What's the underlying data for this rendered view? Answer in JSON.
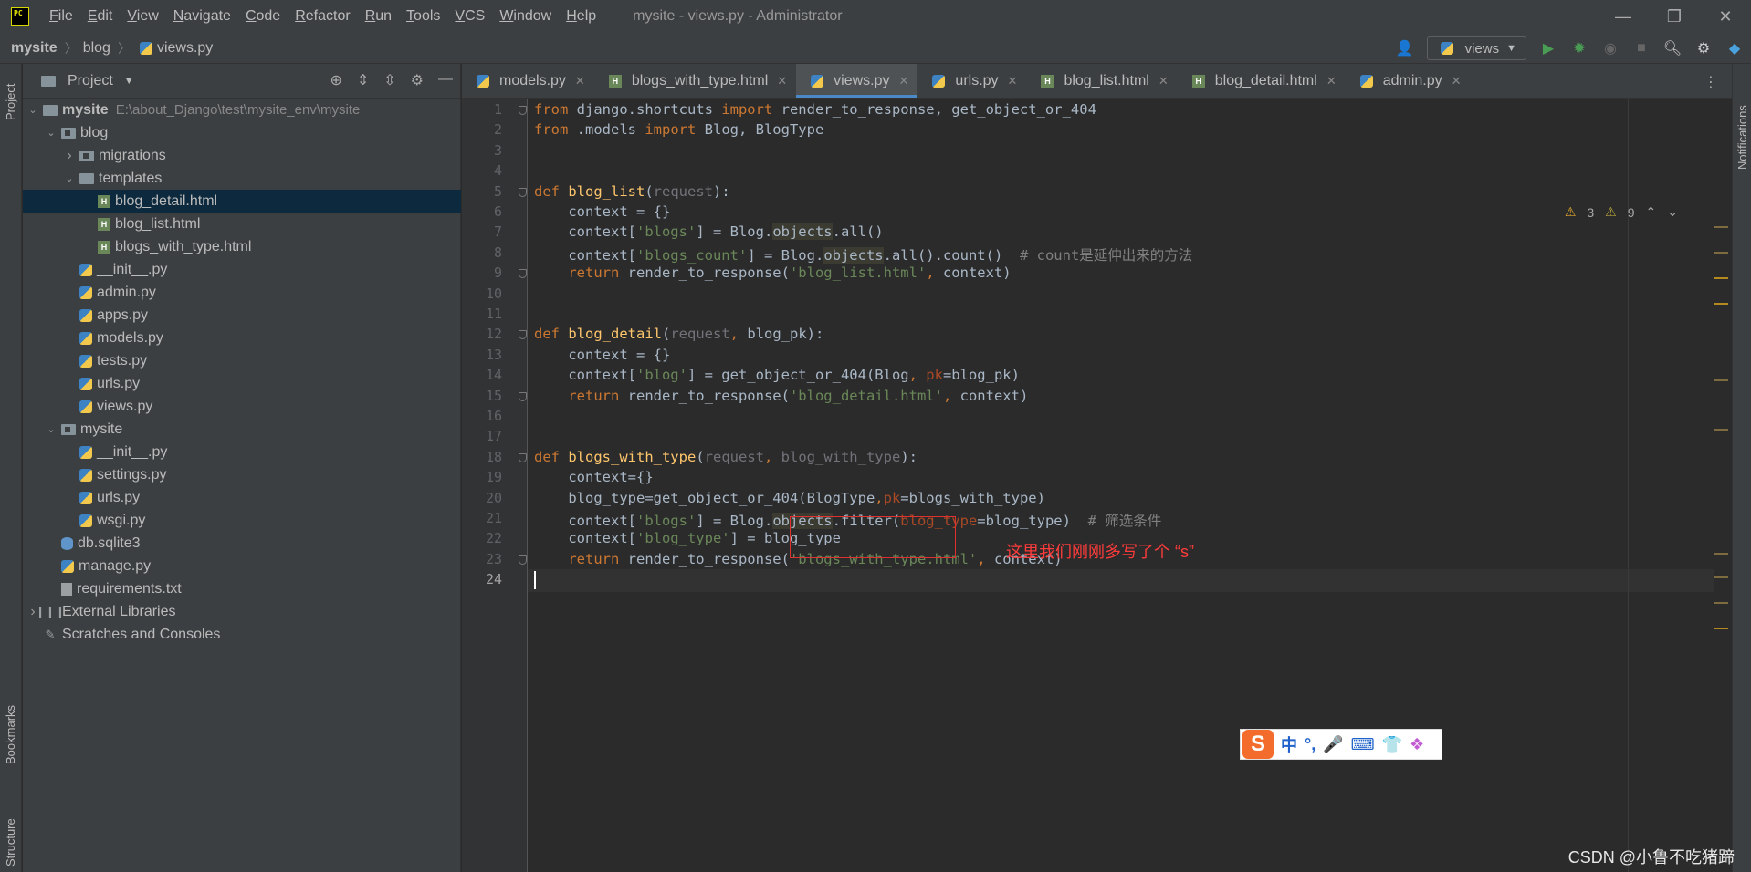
{
  "app": {
    "title": "mysite - views.py - Administrator",
    "logo_text": "PC",
    "menu": [
      {
        "label": "File",
        "key": "F",
        "rest": "ile"
      },
      {
        "label": "Edit",
        "key": "E",
        "rest": "dit"
      },
      {
        "label": "View",
        "key": "V",
        "rest": "iew"
      },
      {
        "label": "Navigate",
        "key": "N",
        "rest": "avigate"
      },
      {
        "label": "Code",
        "key": "C",
        "rest": "ode"
      },
      {
        "label": "Refactor",
        "key": "R",
        "rest": "efactor"
      },
      {
        "label": "Run",
        "key": "R",
        "rest": "un"
      },
      {
        "label": "Tools",
        "key": "T",
        "rest": "ools"
      },
      {
        "label": "VCS",
        "key": "V",
        "rest": "CS"
      },
      {
        "label": "Window",
        "key": "W",
        "rest": "indow"
      },
      {
        "label": "Help",
        "key": "H",
        "rest": "elp"
      }
    ],
    "window_controls": {
      "minimize": "—",
      "restore": "❐",
      "close": "✕"
    }
  },
  "navbar": {
    "breadcrumbs": [
      "mysite",
      "blog",
      "views.py"
    ],
    "run_config": "views",
    "icons": [
      "user-icon",
      "run-icon",
      "debug-icon",
      "coverage-icon",
      "stop-icon",
      "search-icon",
      "settings-icon",
      "toolbox-icon"
    ]
  },
  "left_strip": {
    "project": "Project",
    "bookmarks": "Bookmarks",
    "structure": "Structure"
  },
  "right_strip": {
    "notifications": "Notifications"
  },
  "project_panel": {
    "title": "Project",
    "tree": [
      {
        "label": "mysite",
        "path": "E:\\about_Django\\test\\mysite_env\\mysite",
        "indent": 0,
        "arrow": "v",
        "icon": "folder",
        "bold": true
      },
      {
        "label": "blog",
        "indent": 1,
        "arrow": "v",
        "icon": "package"
      },
      {
        "label": "migrations",
        "indent": 2,
        "arrow": ">",
        "icon": "package"
      },
      {
        "label": "templates",
        "indent": 2,
        "arrow": "v",
        "icon": "folder"
      },
      {
        "label": "blog_detail.html",
        "indent": 3,
        "arrow": "",
        "icon": "html",
        "selected": true
      },
      {
        "label": "blog_list.html",
        "indent": 3,
        "arrow": "",
        "icon": "html"
      },
      {
        "label": "blogs_with_type.html",
        "indent": 3,
        "arrow": "",
        "icon": "html"
      },
      {
        "label": "__init__.py",
        "indent": 2,
        "arrow": "",
        "icon": "py"
      },
      {
        "label": "admin.py",
        "indent": 2,
        "arrow": "",
        "icon": "py"
      },
      {
        "label": "apps.py",
        "indent": 2,
        "arrow": "",
        "icon": "py"
      },
      {
        "label": "models.py",
        "indent": 2,
        "arrow": "",
        "icon": "py"
      },
      {
        "label": "tests.py",
        "indent": 2,
        "arrow": "",
        "icon": "py"
      },
      {
        "label": "urls.py",
        "indent": 2,
        "arrow": "",
        "icon": "py"
      },
      {
        "label": "views.py",
        "indent": 2,
        "arrow": "",
        "icon": "py"
      },
      {
        "label": "mysite",
        "indent": 1,
        "arrow": "v",
        "icon": "package"
      },
      {
        "label": "__init__.py",
        "indent": 2,
        "arrow": "",
        "icon": "py"
      },
      {
        "label": "settings.py",
        "indent": 2,
        "arrow": "",
        "icon": "py"
      },
      {
        "label": "urls.py",
        "indent": 2,
        "arrow": "",
        "icon": "py"
      },
      {
        "label": "wsgi.py",
        "indent": 2,
        "arrow": "",
        "icon": "py"
      },
      {
        "label": "db.sqlite3",
        "indent": 1,
        "arrow": "",
        "icon": "db"
      },
      {
        "label": "manage.py",
        "indent": 1,
        "arrow": "",
        "icon": "py"
      },
      {
        "label": "requirements.txt",
        "indent": 1,
        "arrow": "",
        "icon": "txt"
      },
      {
        "label": "External Libraries",
        "indent": 0,
        "arrow": ">",
        "icon": "lib"
      },
      {
        "label": "Scratches and Consoles",
        "indent": 0,
        "arrow": "",
        "icon": "scratch"
      }
    ]
  },
  "tabs": [
    {
      "label": "models.py",
      "icon": "py",
      "active": false
    },
    {
      "label": "blogs_with_type.html",
      "icon": "html",
      "active": false
    },
    {
      "label": "views.py",
      "icon": "py",
      "active": true
    },
    {
      "label": "urls.py",
      "icon": "py",
      "active": false
    },
    {
      "label": "blog_list.html",
      "icon": "html",
      "active": false
    },
    {
      "label": "blog_detail.html",
      "icon": "html",
      "active": false
    },
    {
      "label": "admin.py",
      "icon": "py",
      "active": false
    }
  ],
  "inspections": {
    "warnings": "3",
    "weak_warnings": "9"
  },
  "editor": {
    "current_line": 24,
    "lines": [
      [
        [
          "kw",
          "from "
        ],
        [
          "",
          "django.shortcuts "
        ],
        [
          "kw",
          "import "
        ],
        [
          "",
          "render_to_response, get_object_or_404"
        ]
      ],
      [
        [
          "kw",
          "from "
        ],
        [
          "",
          ".models "
        ],
        [
          "kw",
          "import "
        ],
        [
          "",
          "Blog, BlogType"
        ]
      ],
      [],
      [],
      [
        [
          "kw",
          "def "
        ],
        [
          "fn",
          "blog_list"
        ],
        [
          "",
          "("
        ],
        [
          "unused",
          "request"
        ],
        [
          "",
          "):"
        ]
      ],
      [
        [
          "",
          "    context = {}"
        ]
      ],
      [
        [
          "",
          "    context["
        ],
        [
          "str",
          "'blogs'"
        ],
        [
          "",
          "] = Blog."
        ],
        [
          "hl",
          "objects"
        ],
        [
          "",
          ".all()"
        ]
      ],
      [
        [
          "",
          "    context["
        ],
        [
          "str",
          "'blogs_count'"
        ],
        [
          "",
          "] = Blog."
        ],
        [
          "hl",
          "objects"
        ],
        [
          "",
          ".all().count()  "
        ],
        [
          "cmt",
          "# count是延伸出来的方法"
        ]
      ],
      [
        [
          "kw",
          "    return "
        ],
        [
          "",
          "render_to_response("
        ],
        [
          "str",
          "'blog_list.html'"
        ],
        [
          "kw",
          ", "
        ],
        [
          "",
          "context)"
        ]
      ],
      [],
      [],
      [
        [
          "kw",
          "def "
        ],
        [
          "fn",
          "blog_detail"
        ],
        [
          "",
          "("
        ],
        [
          "unused",
          "request"
        ],
        [
          "kw",
          ", "
        ],
        [
          "",
          "blog_pk):"
        ]
      ],
      [
        [
          "",
          "    context = {}"
        ]
      ],
      [
        [
          "",
          "    context["
        ],
        [
          "str",
          "'blog'"
        ],
        [
          "",
          "] = get_object_or_404(Blog"
        ],
        [
          "kw",
          ", "
        ],
        [
          "param",
          "pk"
        ],
        [
          "",
          "=blog_pk)"
        ]
      ],
      [
        [
          "kw",
          "    return "
        ],
        [
          "",
          "render_to_response("
        ],
        [
          "str",
          "'blog_detail.html'"
        ],
        [
          "kw",
          ", "
        ],
        [
          "",
          "context)"
        ]
      ],
      [],
      [],
      [
        [
          "kw",
          "def "
        ],
        [
          "fn",
          "blogs_with_type"
        ],
        [
          "",
          "("
        ],
        [
          "unused",
          "request"
        ],
        [
          "kw",
          ", "
        ],
        [
          "unused",
          "blog_with_type"
        ],
        [
          "",
          "):"
        ]
      ],
      [
        [
          "",
          "    context={}"
        ]
      ],
      [
        [
          "",
          "    blog_type=get_object_or_404(BlogType"
        ],
        [
          "kw",
          ","
        ],
        [
          "param",
          "pk"
        ],
        [
          "",
          "=blogs_with_type)"
        ]
      ],
      [
        [
          "",
          "    context["
        ],
        [
          "str",
          "'blogs'"
        ],
        [
          "",
          "] = Blog."
        ],
        [
          "hl",
          "objects"
        ],
        [
          "",
          ".filter("
        ],
        [
          "param",
          "blog_type"
        ],
        [
          "",
          "=blog_type)  "
        ],
        [
          "cmt",
          "# 筛选条件"
        ]
      ],
      [
        [
          "",
          "    context["
        ],
        [
          "str",
          "'blog_type'"
        ],
        [
          "",
          "] = blog_type"
        ]
      ],
      [
        [
          "kw",
          "    return "
        ],
        [
          "",
          "render_to_response("
        ],
        [
          "str",
          "'blogs_with_type.html'"
        ],
        [
          "kw",
          ", "
        ],
        [
          "",
          "context)"
        ]
      ],
      []
    ]
  },
  "annotation": {
    "text": "这里我们刚刚多写了个 “s”"
  },
  "ime": {
    "logo": "S",
    "items": [
      "中",
      "°,",
      "🎤",
      "⌨",
      "👕",
      "❖"
    ]
  },
  "watermark": "CSDN @小鲁不吃猪蹄",
  "colors": {
    "accent": "#4a88c7",
    "annotation": "#e03131",
    "warning": "#e0a72b"
  }
}
